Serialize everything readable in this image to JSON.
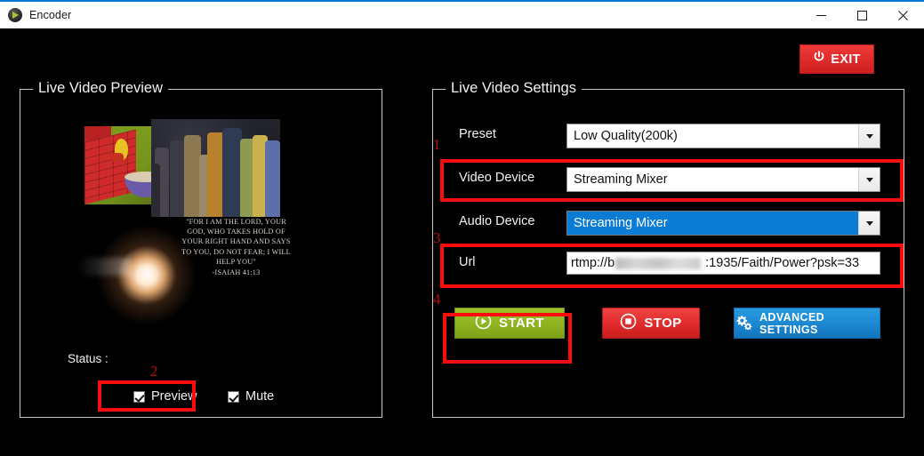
{
  "window": {
    "title": "Encoder",
    "icon": "play-circle-icon",
    "minimize_label": "Minimize",
    "maximize_label": "Maximize",
    "close_label": "Close"
  },
  "exit": {
    "label": "EXIT",
    "icon": "power-icon",
    "color": "#e22b2b"
  },
  "preview_panel": {
    "title": "Live Video Preview",
    "status_label": "Status :",
    "verse_text": "\"FOR I AM THE LORD, YOUR GOD, WHO TAKES HOLD OF YOUR RIGHT HAND AND SAYS TO YOU, DO NOT FEAR; I WILL HELP YOU\"",
    "verse_reference": "-ISAIAH 41:13",
    "checkboxes": [
      {
        "label": "Preview",
        "checked": true
      },
      {
        "label": "Mute",
        "checked": true
      }
    ]
  },
  "settings_panel": {
    "title": "Live Video Settings",
    "rows": [
      {
        "label": "Preset",
        "value": "Low Quality(200k)",
        "type": "combobox",
        "selected": false
      },
      {
        "label": "Video Device",
        "value": "Streaming Mixer",
        "type": "combobox",
        "selected": false
      },
      {
        "label": "Audio Device",
        "value": "Streaming Mixer",
        "type": "combobox",
        "selected": true
      },
      {
        "label": "Url",
        "value_prefix": "rtmp://b",
        "value_suffix": ":1935/Faith/Power?psk=33",
        "type": "textbox",
        "redacted": true
      }
    ]
  },
  "actions": {
    "start": {
      "label": "START",
      "icon": "play-circle-icon",
      "color": "#8fb420"
    },
    "stop": {
      "label": "STOP",
      "icon": "stop-circle-icon",
      "color": "#e02a2a"
    },
    "advanced": {
      "label": "ADVANCED SETTINGS",
      "icon": "gears-icon",
      "color": "#1b87d0"
    }
  },
  "annotations": {
    "color": "#fc0d0d",
    "numbers": [
      "1",
      "2",
      "3",
      "4"
    ]
  }
}
